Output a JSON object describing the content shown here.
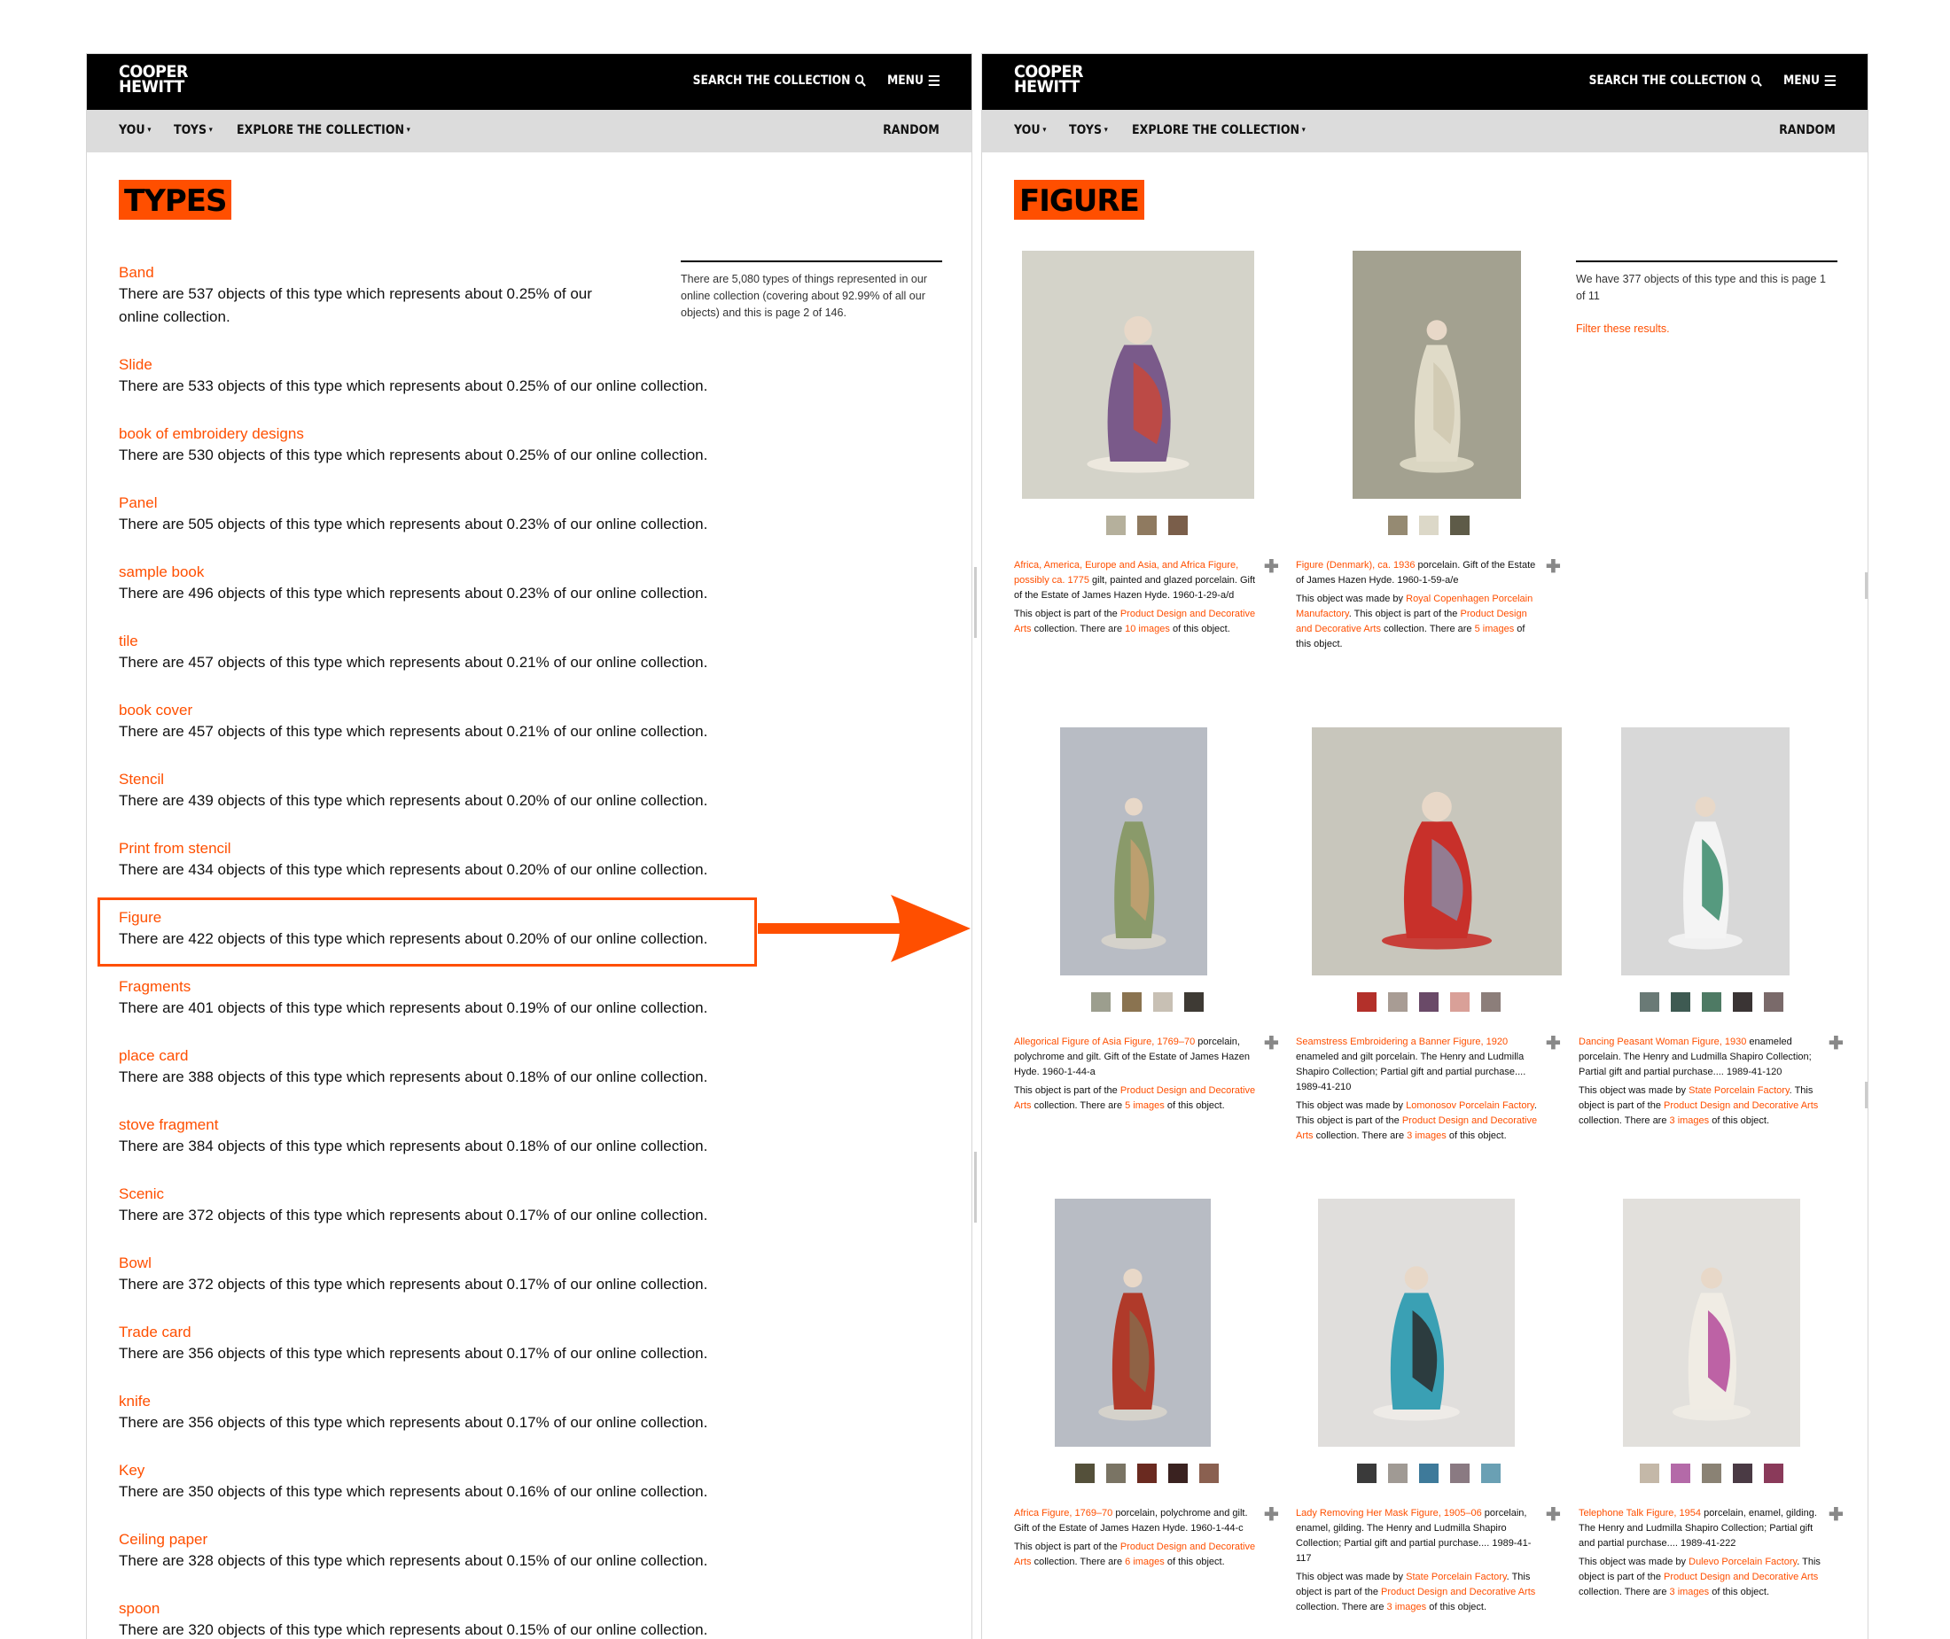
{
  "brand": {
    "line1": "COOPER",
    "line2": "HEWITT"
  },
  "header": {
    "search_label": "SEARCH THE COLLECTION",
    "menu_label": "MENU"
  },
  "nav": {
    "items": [
      "YOU",
      "TOYS",
      "EXPLORE THE COLLECTION"
    ],
    "random_label": "RANDOM"
  },
  "colors": {
    "accent": "#ff4f00",
    "topbar": "#000000",
    "subnav": "#dcdcdc"
  },
  "left_page": {
    "title": "TYPES",
    "info": "There are 5,080 types of things represented in our online collection (covering about 92.99% of all our objects) and this is page 2 of 146.",
    "types": [
      {
        "name": "Band",
        "desc": "There are 537 objects of this type which represents about 0.25% of our online collection."
      },
      {
        "name": "Slide",
        "desc": "There are 533 objects of this type which represents about 0.25% of our online collection."
      },
      {
        "name": "book of embroidery designs",
        "desc": "There are 530 objects of this type which represents about 0.25% of our online collection."
      },
      {
        "name": "Panel",
        "desc": "There are 505 objects of this type which represents about 0.23% of our online collection."
      },
      {
        "name": "sample book",
        "desc": "There are 496 objects of this type which represents about 0.23% of our online collection."
      },
      {
        "name": "tile",
        "desc": "There are 457 objects of this type which represents about 0.21% of our online collection."
      },
      {
        "name": "book cover",
        "desc": "There are 457 objects of this type which represents about 0.21% of our online collection."
      },
      {
        "name": "Stencil",
        "desc": "There are 439 objects of this type which represents about 0.20% of our online collection."
      },
      {
        "name": "Print from stencil",
        "desc": "There are 434 objects of this type which represents about 0.20% of our online collection."
      },
      {
        "name": "Figure",
        "desc": "There are 422 objects of this type which represents about 0.20% of our online collection."
      },
      {
        "name": "Fragments",
        "desc": "There are 401 objects of this type which represents about 0.19% of our online collection."
      },
      {
        "name": "place card",
        "desc": "There are 388 objects of this type which represents about 0.18% of our online collection."
      },
      {
        "name": "stove fragment",
        "desc": "There are 384 objects of this type which represents about 0.18% of our online collection."
      },
      {
        "name": "Scenic",
        "desc": "There are 372 objects of this type which represents about 0.17% of our online collection."
      },
      {
        "name": "Bowl",
        "desc": "There are 372 objects of this type which represents about 0.17% of our online collection."
      },
      {
        "name": "Trade card",
        "desc": "There are 356 objects of this type which represents about 0.17% of our online collection."
      },
      {
        "name": "knife",
        "desc": "There are 356 objects of this type which represents about 0.17% of our online collection."
      },
      {
        "name": "Key",
        "desc": "There are 350 objects of this type which represents about 0.16% of our online collection."
      },
      {
        "name": "Ceiling paper",
        "desc": "There are 328 objects of this type which represents about 0.15% of our online collection."
      },
      {
        "name": "spoon",
        "desc": "There are 320 objects of this type which represents about 0.15% of our online collection."
      }
    ]
  },
  "right_page": {
    "title": "FIGURE",
    "info": "We have 377 objects of this type and this is page 1 of 11",
    "filter_label": "Filter these results.",
    "objects": [
      {
        "title": "Africa, America, Europe and Asia, and Africa Figure, possibly ca. 1775",
        "desc": " gilt, painted and glazed porcelain. Gift of the Estate of James Hazen Hyde. 1960-1-29-a/d",
        "maker": "",
        "part_pre": "This object is part of the ",
        "collection": "Product Design and Decorative Arts",
        "images_pre": " collection. There are ",
        "images": "10 images",
        "images_post": " of this object.",
        "swatches": [
          "#b5b09c",
          "#8f7a60",
          "#7a5e4a"
        ]
      },
      {
        "title": "Figure (Denmark), ca. 1936",
        "desc": " porcelain. Gift of the Estate of James Hazen Hyde. 1960-1-59-a/e",
        "maker_pre": "This object was made by ",
        "maker": "Royal Copenhagen Porcelain Manufactory",
        "maker_post": ". ",
        "part_pre": "This object is part of the ",
        "collection": "Product Design and Decorative Arts",
        "images_pre": " collection. There are ",
        "images": "5 images",
        "images_post": " of this object.",
        "swatches": [
          "#958a72",
          "#dcd8c8",
          "#5e5b48"
        ]
      },
      {
        "title": "Allegorical Figure of Asia Figure, 1769–70",
        "desc": " porcelain, polychrome and gilt. Gift of the Estate of James Hazen Hyde. 1960-1-44-a",
        "maker": "",
        "part_pre": "This object is part of the ",
        "collection": "Product Design and Decorative Arts",
        "images_pre": " collection. There are ",
        "images": "5 images",
        "images_post": " of this object.",
        "swatches": [
          "#9c9e8e",
          "#8a7350",
          "#c8c0b4",
          "#3e3a34"
        ]
      },
      {
        "title": "Seamstress Embroidering a Banner Figure, 1920",
        "desc": " enameled and gilt porcelain. The Henry and Ludmilla Shapiro Collection; Partial gift and partial purchase.... 1989-41-210",
        "maker_pre": "This object was made by ",
        "maker": "Lomonosov Porcelain Factory",
        "maker_post": ". ",
        "part_pre": "This object is part of the ",
        "collection": "Product Design and Decorative Arts",
        "images_pre": " collection. There are ",
        "images": "3 images",
        "images_post": " of this object.",
        "swatches": [
          "#b3302a",
          "#a89c94",
          "#6a4a68",
          "#d9a098",
          "#8c7e7a"
        ]
      },
      {
        "title": "Dancing Peasant Woman Figure, 1930",
        "desc": " enameled porcelain. The Henry and Ludmilla Shapiro Collection; Partial gift and partial purchase.... 1989-41-120",
        "maker_pre": "This object was made by ",
        "maker": "State Porcelain Factory",
        "maker_post": ". ",
        "part_pre": "This object is part of the ",
        "collection": "Product Design and Decorative Arts",
        "images_pre": " collection. There are ",
        "images": "3 images",
        "images_post": " of this object.",
        "swatches": [
          "#6a7a76",
          "#3e5a52",
          "#4e7a64",
          "#3a3434",
          "#7a6a6a"
        ]
      },
      {
        "title": "Africa Figure, 1769–70",
        "desc": " porcelain, polychrome and gilt. Gift of the Estate of James Hazen Hyde. 1960-1-44-c",
        "maker": "",
        "part_pre": "This object is part of the ",
        "collection": "Product Design and Decorative Arts",
        "images_pre": " collection. There are ",
        "images": "6 images",
        "images_post": " of this object.",
        "swatches": [
          "#54503a",
          "#7a7464",
          "#6a2a20",
          "#3a2220",
          "#8a6050"
        ]
      },
      {
        "title": "Lady Removing Her Mask Figure, 1905–06",
        "desc": " porcelain, enamel, gilding. The Henry and Ludmilla Shapiro Collection; Partial gift and partial purchase.... 1989-41-117",
        "maker_pre": "This object was made by ",
        "maker": "State Porcelain Factory",
        "maker_post": ". ",
        "part_pre": "This object is part of the ",
        "collection": "Product Design and Decorative Arts",
        "images_pre": " collection. There are ",
        "images": "3 images",
        "images_post": " of this object.",
        "swatches": [
          "#3a3a3a",
          "#a09a94",
          "#3e7a9a",
          "#8a7a82",
          "#6aa0b4"
        ]
      },
      {
        "title": "Telephone Talk Figure, 1954",
        "desc": " porcelain, enamel, gilding. The Henry and Ludmilla Shapiro Collection; Partial gift and partial purchase.... 1989-41-222",
        "maker_pre": "This object was made by ",
        "maker": "Dulevo Porcelain Factory",
        "maker_post": ". ",
        "part_pre": "This object is part of the ",
        "collection": "Product Design and Decorative Arts",
        "images_pre": " collection. There are ",
        "images": "3 images",
        "images_post": " of this object.",
        "swatches": [
          "#c4b8a8",
          "#b46aa8",
          "#8a8274",
          "#4a3a44",
          "#8a3a5a"
        ]
      }
    ]
  }
}
